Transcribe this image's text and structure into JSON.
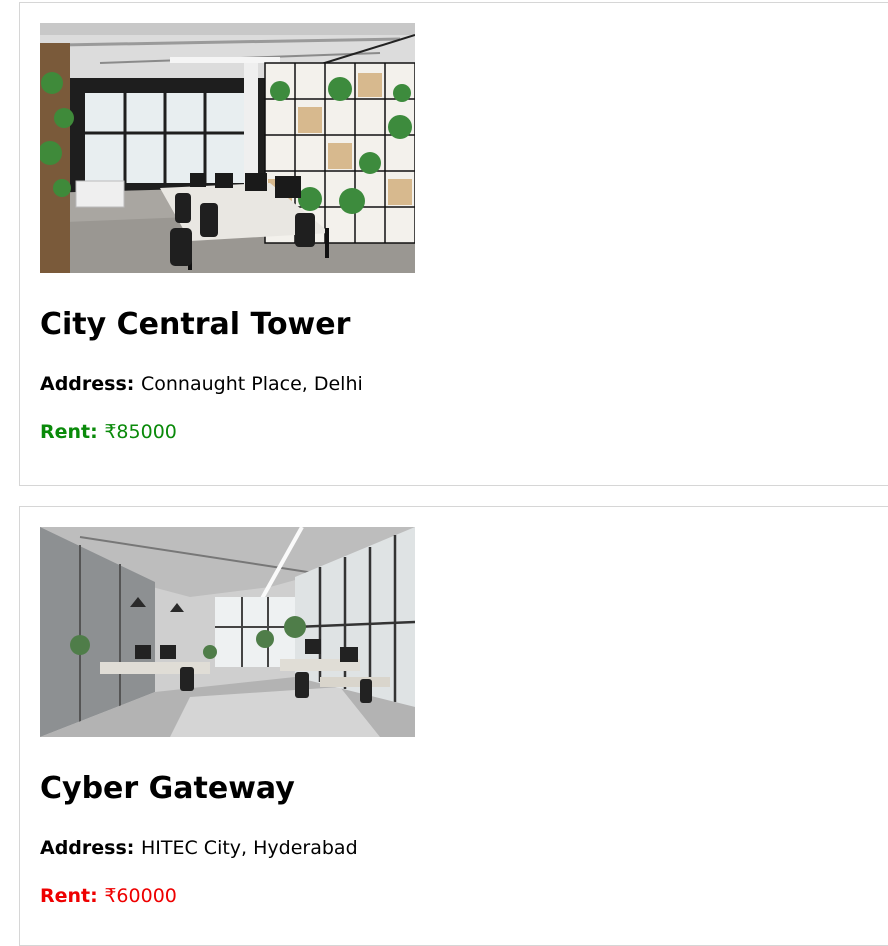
{
  "listings": [
    {
      "name": "City Central Tower",
      "address_label": "Address:",
      "address": "Connaught Place, Delhi",
      "rent_label": "Rent:",
      "rent": "₹85000",
      "rent_color": "#0a8a0a"
    },
    {
      "name": "Cyber Gateway",
      "address_label": "Address:",
      "address": "HITEC City, Hyderabad",
      "rent_label": "Rent:",
      "rent": "₹60000",
      "rent_color": "#ee0000"
    }
  ]
}
